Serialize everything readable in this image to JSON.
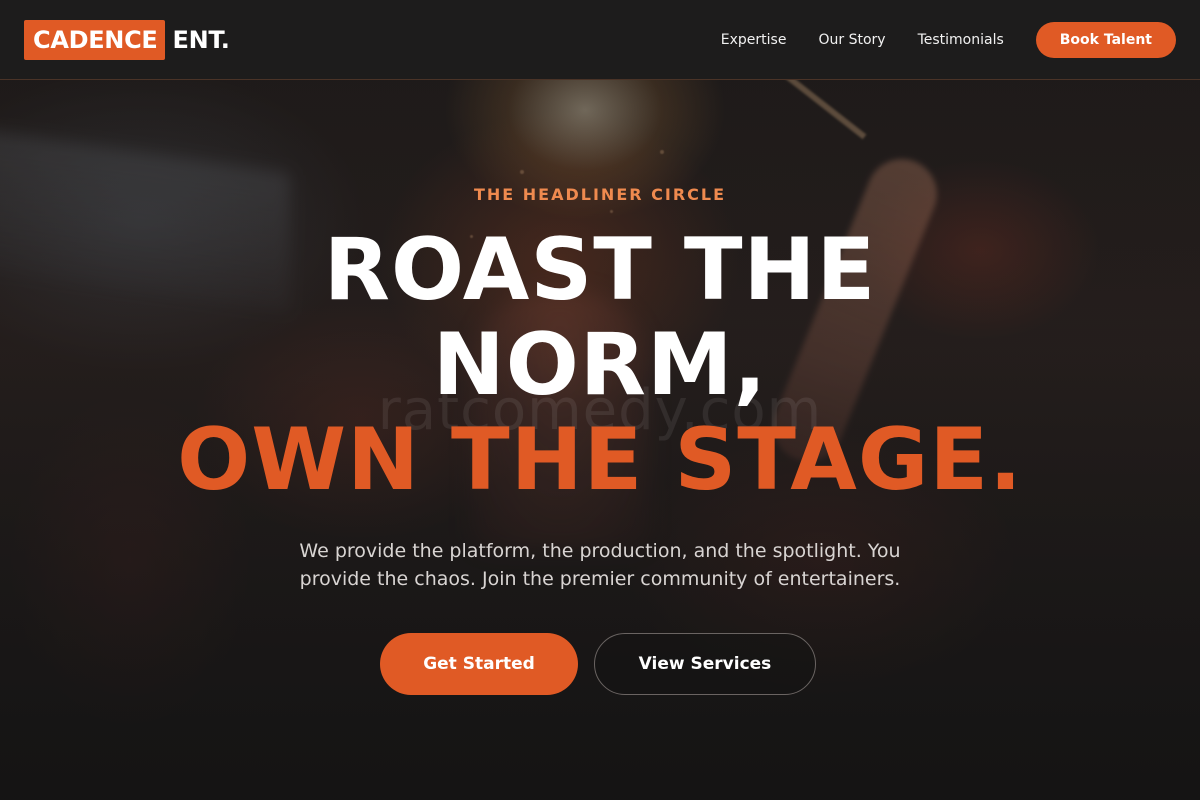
{
  "brand": {
    "logo_box_text": "CADENCE",
    "logo_suffix": "ENT."
  },
  "nav": {
    "links": [
      {
        "label": "Expertise"
      },
      {
        "label": "Our Story"
      },
      {
        "label": "Testimonials"
      }
    ],
    "cta_label": "Book Talent"
  },
  "hero": {
    "eyebrow": "THE HEADLINER CIRCLE",
    "headline_line1": "ROAST THE",
    "headline_line2": "NORM,",
    "headline_line3": "OWN THE STAGE.",
    "subtext": "We provide the platform, the production, and the spotlight. You provide the chaos. Join the premier community of entertainers.",
    "primary_cta": "Get Started",
    "secondary_cta": "View Services"
  },
  "watermark": "ratcomedy.com",
  "colors": {
    "accent": "#e05a25",
    "eyebrow": "#ef8a4f",
    "header_bg": "#1d1c1c",
    "text_primary": "#ffffff",
    "text_muted": "#d8d4d2"
  }
}
